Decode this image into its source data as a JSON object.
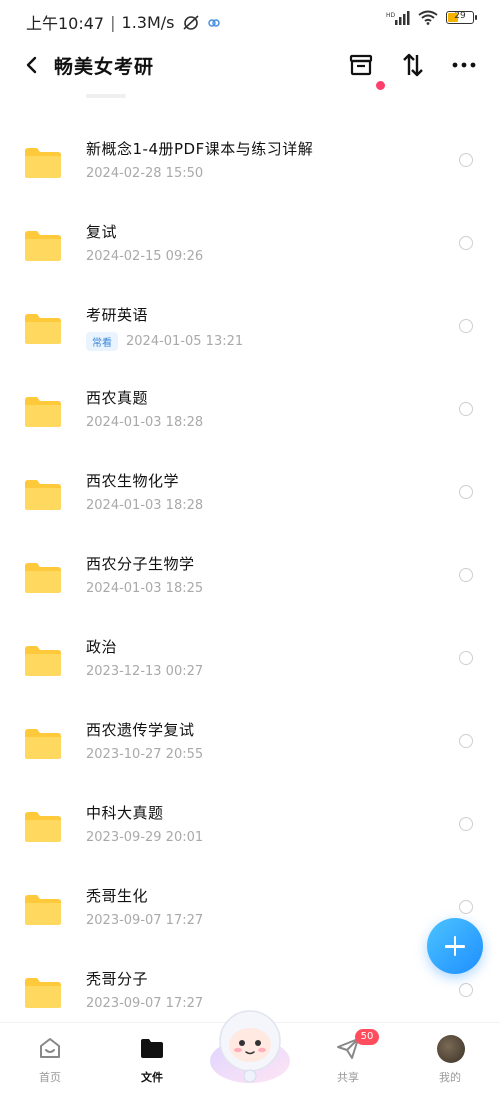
{
  "status_bar": {
    "time": "上午10:47",
    "speed": "1.3M/s",
    "battery": "29"
  },
  "header": {
    "title": "畅美女考研"
  },
  "files": [
    {
      "name": "新概念1-4册PDF课本与练习详解",
      "date": "2024-02-28 15:50",
      "badge": null
    },
    {
      "name": "复试",
      "date": "2024-02-15 09:26",
      "badge": null
    },
    {
      "name": "考研英语",
      "date": "2024-01-05 13:21",
      "badge": "常看"
    },
    {
      "name": "西农真题",
      "date": "2024-01-03 18:28",
      "badge": null
    },
    {
      "name": "西农生物化学",
      "date": "2024-01-03 18:28",
      "badge": null
    },
    {
      "name": "西农分子生物学",
      "date": "2024-01-03 18:25",
      "badge": null
    },
    {
      "name": "政治",
      "date": "2023-12-13 00:27",
      "badge": null
    },
    {
      "name": "西农遗传学复试",
      "date": "2023-10-27 20:55",
      "badge": null
    },
    {
      "name": "中科大真题",
      "date": "2023-09-29 20:01",
      "badge": null
    },
    {
      "name": "秃哥生化",
      "date": "2023-09-07 17:27",
      "badge": null
    },
    {
      "name": "秃哥分子",
      "date": "2023-09-07 17:27",
      "badge": null
    }
  ],
  "tabs": {
    "home": "首页",
    "files": "文件",
    "share": "共享",
    "share_count": "50",
    "mine": "我的"
  },
  "colors": {
    "accent": "#1e8fff",
    "folder": "#ffc93c",
    "badge_red": "#ff4d5e"
  }
}
